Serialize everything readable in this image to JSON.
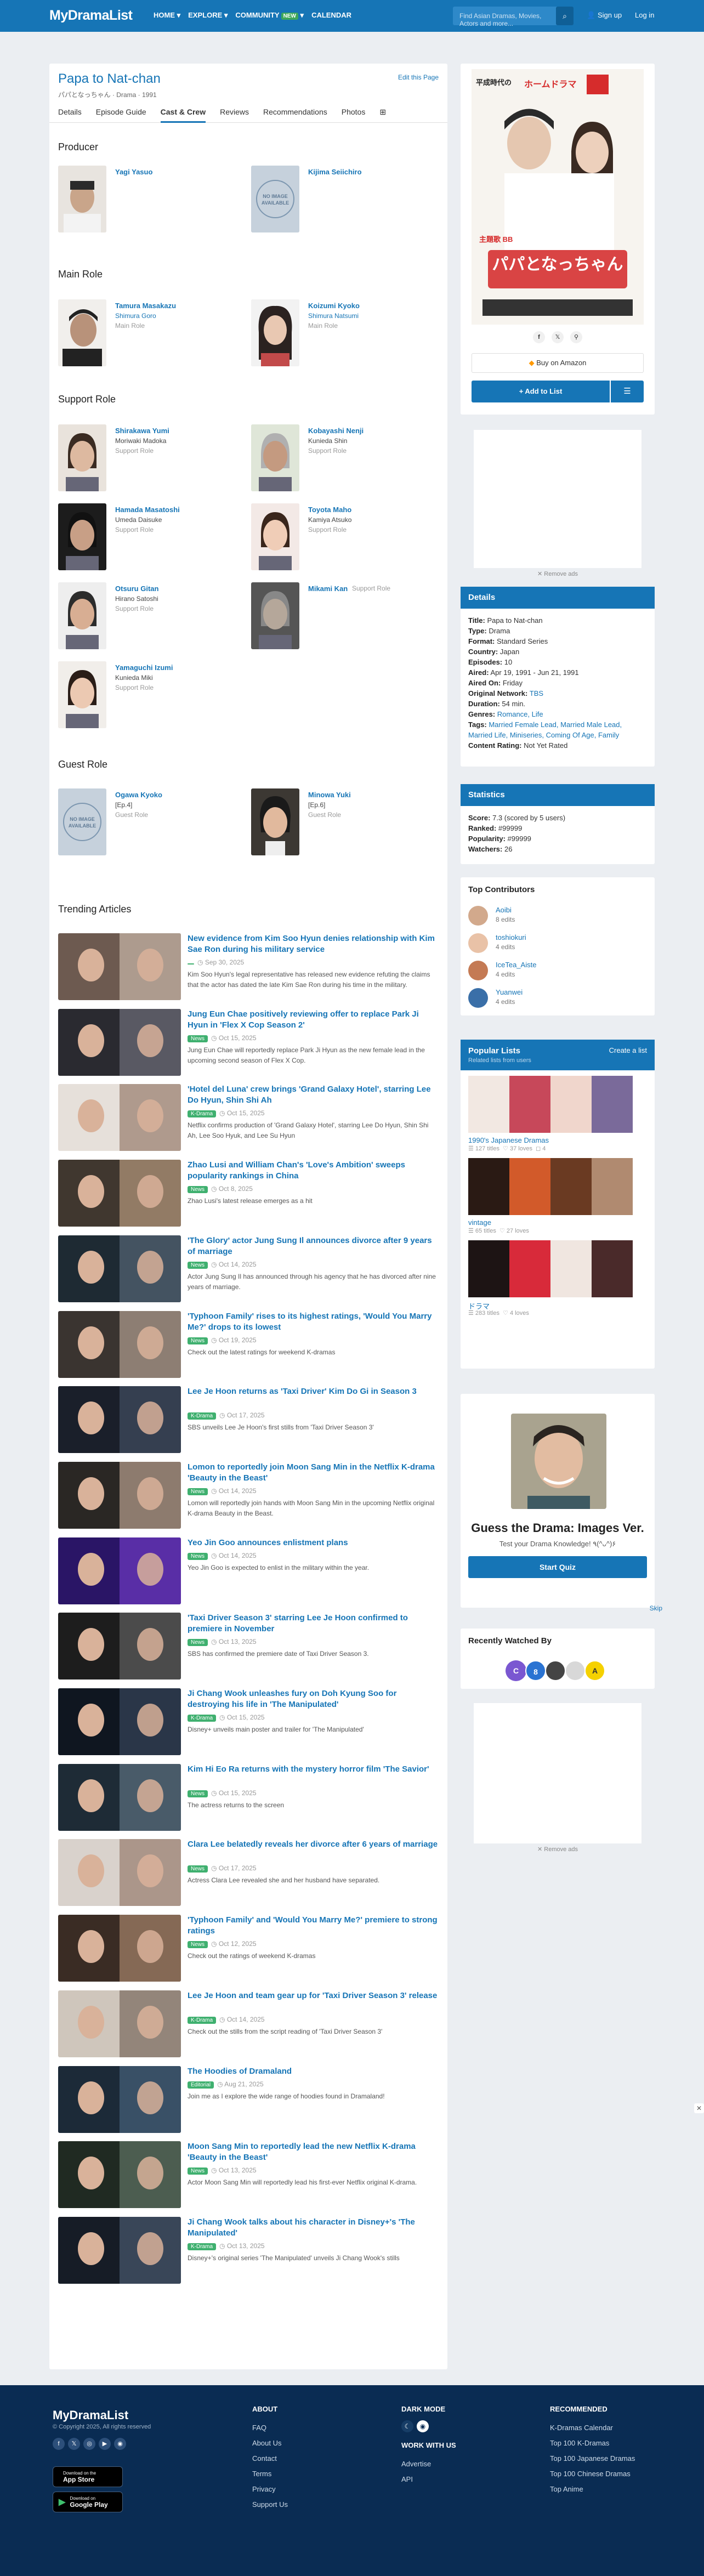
{
  "nav": {
    "logo": "MyDramaList",
    "items": [
      "HOME ▾",
      "EXPLORE ▾",
      "COMMUNITY",
      "CALENDAR"
    ],
    "new_badge": "NEW",
    "search_placeholder": "Find Asian Dramas, Movies, Actors and more...",
    "signup": "Sign up",
    "login": "Log in"
  },
  "show": {
    "title": "Papa to Nat-chan",
    "subtitle": "パパとなっちゃん · Drama · 1991",
    "edit": "Edit this Page"
  },
  "tabs": [
    "Details",
    "Episode Guide",
    "Cast & Crew",
    "Reviews",
    "Recommendations",
    "Photos",
    "⊞"
  ],
  "sections": {
    "producer": "Producer",
    "main_role": "Main Role",
    "support_role": "Support Role",
    "guest_role": "Guest Role",
    "trending": "Trending Articles"
  },
  "producers": [
    {
      "name": "Yagi Yasuo"
    },
    {
      "name": "Kijima Seiichiro"
    }
  ],
  "main_cast": [
    {
      "name": "Tamura Masakazu",
      "char": "Shimura Goro",
      "role": "Main Role"
    },
    {
      "name": "Koizumi Kyoko",
      "char": "Shimura Natsumi",
      "role": "Main Role"
    }
  ],
  "support_cast": [
    {
      "name": "Shirakawa Yumi",
      "char": "Moriwaki Madoka",
      "role": "Support Role"
    },
    {
      "name": "Kobayashi Nenji",
      "char": "Kunieda Shin",
      "role": "Support Role"
    },
    {
      "name": "Hamada Masatoshi",
      "char": "Umeda Daisuke",
      "role": "Support Role"
    },
    {
      "name": "Toyota Maho",
      "char": "Kamiya Atsuko",
      "role": "Support Role"
    },
    {
      "name": "Otsuru Gitan",
      "char": "Hirano Satoshi",
      "role": "Support Role"
    },
    {
      "name": "Mikami Kan",
      "char": "",
      "role": "Support Role"
    },
    {
      "name": "Yamaguchi Izumi",
      "char": "Kunieda Miki",
      "role": "Support Role"
    }
  ],
  "guest_cast": [
    {
      "name": "Ogawa Kyoko",
      "char": "[Ep.4]",
      "role": "Guest Role"
    },
    {
      "name": "Minowa Yuki",
      "char": "[Ep.6]",
      "role": "Guest Role"
    }
  ],
  "placeholder": {
    "l1": "NO IMAGE",
    "l2": "AVAILABLE"
  },
  "articles": [
    {
      "title": "New evidence from Kim Soo Hyun denies relationship with Kim Sae Ron during his military service",
      "tag": "",
      "date": "Sep 30, 2025",
      "desc": "Kim Soo Hyun's legal representative has released new evidence refuting the claims that the actor has dated the late Kim Sae Ron during his time in the military."
    },
    {
      "title": "Jung Eun Chae positively reviewing offer to replace Park Ji Hyun in 'Flex X Cop Season 2'",
      "tag": "News",
      "date": "Oct 15, 2025",
      "desc": "Jung Eun Chae will reportedly replace Park Ji Hyun as the new female lead in the upcoming second season of Flex X Cop."
    },
    {
      "title": "'Hotel del Luna' crew brings 'Grand Galaxy Hotel', starring Lee Do Hyun, Shin Shi Ah",
      "tag": "K-Drama",
      "date": "Oct 15, 2025",
      "desc": "Netflix confirms production of 'Grand Galaxy Hotel', starring Lee Do Hyun, Shin Shi Ah, Lee Soo Hyuk, and Lee Su Hyun"
    },
    {
      "title": "Zhao Lusi and William Chan's 'Love's Ambition' sweeps popularity rankings in China",
      "tag": "News",
      "date": "Oct 8, 2025",
      "desc": "Zhao Lusi's latest release emerges as a hit"
    },
    {
      "title": "'The Glory' actor Jung Sung Il announces divorce after 9 years of marriage",
      "tag": "News",
      "date": "Oct 14, 2025",
      "desc": "Actor Jung Sung Il has announced through his agency that he has divorced after nine years of marriage."
    },
    {
      "title": "'Typhoon Family' rises to its highest ratings, 'Would You Marry Me?' drops to its lowest",
      "tag": "News",
      "date": "Oct 19, 2025",
      "desc": "Check out the latest ratings for weekend K-dramas"
    },
    {
      "title": "Lee Je Hoon returns as 'Taxi Driver' Kim Do Gi in Season 3",
      "tag": "K-Drama",
      "date": "Oct 17, 2025",
      "desc": "SBS unveils Lee Je Hoon's first stills from 'Taxi Driver Season 3'"
    },
    {
      "title": "Lomon to reportedly join Moon Sang Min in the Netflix K-drama 'Beauty in the Beast'",
      "tag": "News",
      "date": "Oct 14, 2025",
      "desc": "Lomon will reportedly join hands with Moon Sang Min in the upcoming Netflix original K-drama Beauty in the Beast."
    },
    {
      "title": "Yeo Jin Goo announces enlistment plans",
      "tag": "News",
      "date": "Oct 14, 2025",
      "desc": "Yeo Jin Goo is expected to enlist in the military within the year."
    },
    {
      "title": "'Taxi Driver Season 3' starring Lee Je Hoon confirmed to premiere in November",
      "tag": "News",
      "date": "Oct 13, 2025",
      "desc": "SBS has confirmed the premiere date of Taxi Driver Season 3."
    },
    {
      "title": "Ji Chang Wook unleashes fury on Doh Kyung Soo for destroying his life in 'The Manipulated'",
      "tag": "K-Drama",
      "date": "Oct 15, 2025",
      "desc": "Disney+ unveils main poster and trailer for 'The Manipulated'"
    },
    {
      "title": "Kim Hi Eo Ra returns with the mystery horror film 'The Savior'",
      "tag": "News",
      "date": "Oct 15, 2025",
      "desc": "The actress returns to the screen"
    },
    {
      "title": "Clara Lee belatedly reveals her divorce after 6 years of marriage",
      "tag": "News",
      "date": "Oct 17, 2025",
      "desc": "Actress Clara Lee revealed she and her husband have separated."
    },
    {
      "title": "'Typhoon Family' and 'Would You Marry Me?' premiere to strong ratings",
      "tag": "News",
      "date": "Oct 12, 2025",
      "desc": "Check out the ratings of weekend K-dramas"
    },
    {
      "title": "Lee Je Hoon and team gear up for 'Taxi Driver Season 3' release",
      "tag": "K-Drama",
      "date": "Oct 14, 2025",
      "desc": "Check out the stills from the script reading of 'Taxi Driver Season 3'"
    },
    {
      "title": "The Hoodies of Dramaland",
      "tag": "Editorial",
      "date": "Aug 21, 2025",
      "desc": "Join me as I explore the wide range of hoodies found in Dramaland!"
    },
    {
      "title": "Moon Sang Min to reportedly lead the new Netflix K-drama 'Beauty in the Beast'",
      "tag": "News",
      "date": "Oct 13, 2025",
      "desc": "Actor Moon Sang Min will reportedly lead his first-ever Netflix original K-drama."
    },
    {
      "title": "Ji Chang Wook talks about his character in Disney+'s 'The Manipulated'",
      "tag": "K-Drama",
      "date": "Oct 13, 2025",
      "desc": "Disney+'s original series 'The Manipulated' unveils Ji Chang Wook's stills"
    }
  ],
  "poster": {
    "t1": "平成時代の",
    "t2": "ホームドラマ",
    "t3": "パパと",
    "t4": "なっちゃん",
    "t5": "主題歌 BB"
  },
  "actions": {
    "amazon": "Buy on Amazon",
    "add": "+ Add to List",
    "menu": "☰"
  },
  "ads": {
    "remove": "✕ Remove ads"
  },
  "details": {
    "head": "Details",
    "rows": [
      {
        "k": "Title:",
        "v": "Papa to Nat-chan"
      },
      {
        "k": "Type:",
        "v": "Drama"
      },
      {
        "k": "Format:",
        "v": "Standard Series"
      },
      {
        "k": "Country:",
        "v": "Japan"
      },
      {
        "k": "Episodes:",
        "v": "10"
      },
      {
        "k": "Aired:",
        "v": "Apr 19, 1991 - Jun 21, 1991"
      },
      {
        "k": "Aired On:",
        "v": "Friday"
      },
      {
        "k": "Original Network:",
        "v": "TBS"
      },
      {
        "k": "Duration:",
        "v": "54 min."
      },
      {
        "k": "Genres:",
        "v": "Romance, Life"
      },
      {
        "k": "Tags:",
        "v": "Married Female Lead, Married Male Lead, Married Life, Miniseries, Coming Of Age, Family"
      },
      {
        "k": "Content Rating:",
        "v": "Not Yet Rated"
      }
    ]
  },
  "stats": {
    "head": "Statistics",
    "rows": [
      {
        "k": "Score:",
        "v": "7.3 (scored by 5 users)"
      },
      {
        "k": "Ranked:",
        "v": "#99999"
      },
      {
        "k": "Popularity:",
        "v": "#99999"
      },
      {
        "k": "Watchers:",
        "v": "26"
      }
    ]
  },
  "contributors": {
    "head": "Top Contributors",
    "items": [
      {
        "name": "Aoibi",
        "edits": "8 edits"
      },
      {
        "name": "toshiokuri",
        "edits": "4 edits"
      },
      {
        "name": "IceTea_Aiste",
        "edits": "4 edits"
      },
      {
        "name": "Yuanwei",
        "edits": "4 edits"
      }
    ]
  },
  "popular": {
    "head": "Popular Lists",
    "create": "Create a list",
    "sub": "Related lists from users",
    "lists": [
      {
        "name": "1990's Japanese Dramas",
        "loves": "127 titles",
        "views": "37 loves",
        "comments": "4"
      },
      {
        "name": "vintage",
        "loves": "65 titles",
        "views": "27 loves",
        "comments": ""
      },
      {
        "name": "ドラマ",
        "loves": "283 titles",
        "views": "4 loves",
        "comments": ""
      }
    ]
  },
  "quiz": {
    "title": "Guess the Drama: Images Ver.",
    "desc": "Test your Drama Knowledge! ٩(^ᴗ^)۶",
    "btn": "Start Quiz",
    "skip": "Skip"
  },
  "recent": {
    "head": "Recently Watched By",
    "avatars": [
      "C",
      "8",
      "",
      "",
      ""
    ]
  },
  "footer": {
    "logo": "MyDramaList",
    "copy": "© Copyright 2025, All rights reserved",
    "about_h": "ABOUT",
    "about": [
      "FAQ",
      "About Us",
      "Contact",
      "Terms",
      "Privacy",
      "Support Us"
    ],
    "dark_h": "DARK MODE",
    "work_h": "WORK WITH US",
    "work": [
      "Advertise",
      "API"
    ],
    "rec_h": "RECOMMENDED",
    "rec": [
      "K-Dramas Calendar",
      "Top 100 K-Dramas",
      "Top 100 Japanese Dramas",
      "Top 100 Chinese Dramas",
      "Top Anime"
    ],
    "appstore_s": "Download on the",
    "appstore": "App Store",
    "gplay_s": "Download on",
    "gplay": "Google Play"
  },
  "colors": {
    "brand": "#1675b6",
    "footer": "#0a2c53",
    "tag": "#3fb06f"
  }
}
